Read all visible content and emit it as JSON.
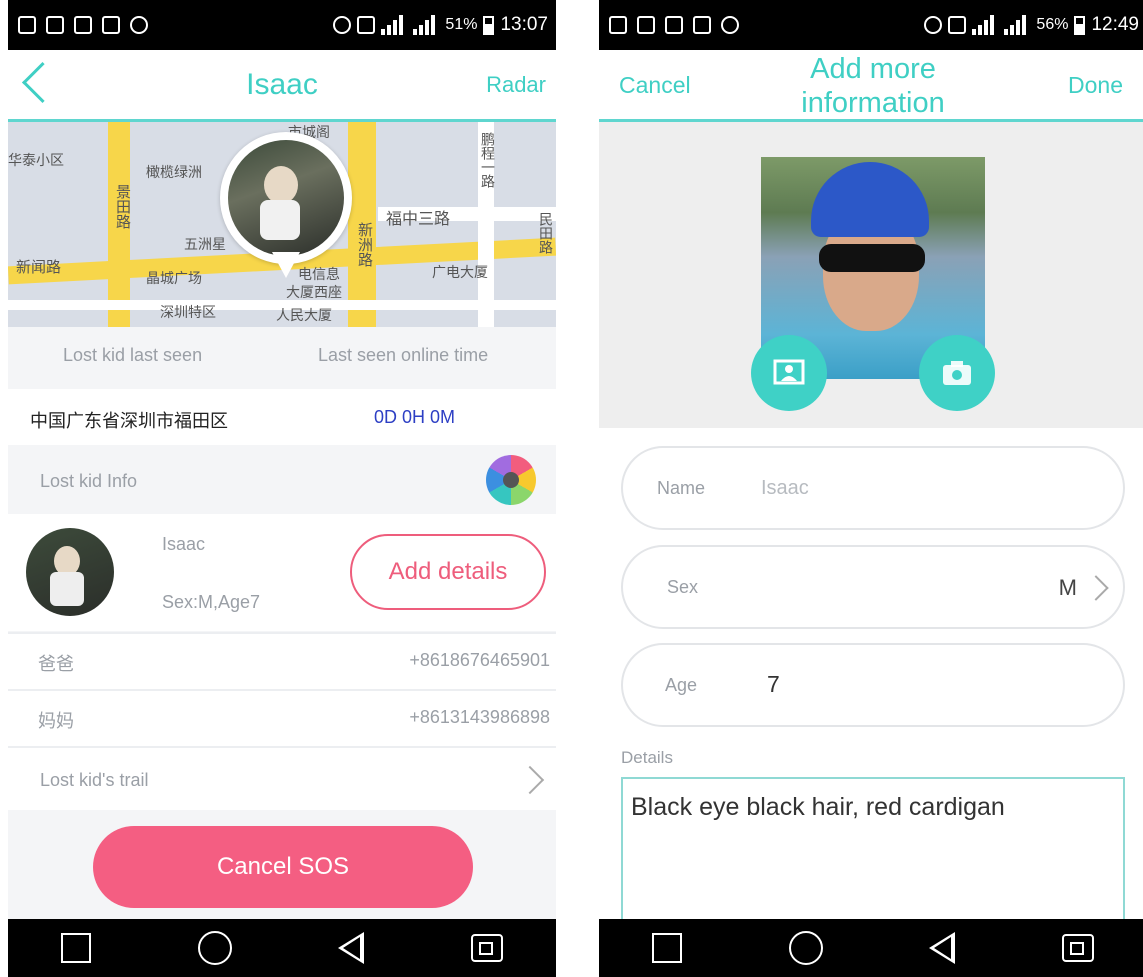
{
  "left": {
    "status": {
      "battery": "51%",
      "time": "13:07"
    },
    "header": {
      "title": "Isaac",
      "action": "Radar"
    },
    "map": {
      "labels": [
        "华泰小区",
        "橄榄绿洲",
        "景田路",
        "五洲星",
        "晶城广场",
        "电信息",
        "大厦西座",
        "深圳特区",
        "人民大厦",
        "福中三路",
        "新洲路",
        "广电大厦",
        "鹏程一路",
        "民田路",
        "新闻路",
        "市城阁"
      ]
    },
    "last_seen": {
      "label": "Lost kid last seen",
      "online_label": "Last seen online time"
    },
    "location": {
      "address": "中国广东省深圳市福田区",
      "elapsed": "0D 0H 0M"
    },
    "info_section": {
      "label": "Lost kid Info"
    },
    "profile": {
      "name": "Isaac",
      "details": "Sex:M,Age7",
      "add_details": "Add details"
    },
    "contacts": [
      {
        "relation": "爸爸",
        "phone": "+8618676465901"
      },
      {
        "relation": "妈妈",
        "phone": "+8613143986898"
      }
    ],
    "trail": {
      "label": "Lost kid's trail"
    },
    "sos": {
      "label": "Cancel SOS"
    },
    "colors": {
      "accent": "#3fcfc4",
      "danger": "#f45e82"
    }
  },
  "right": {
    "status": {
      "battery": "56%",
      "time": "12:49"
    },
    "header": {
      "cancel": "Cancel",
      "title_line1": "Add more",
      "title_line2": "information",
      "done": "Done"
    },
    "form": {
      "name": {
        "label": "Name",
        "placeholder": "Isaac"
      },
      "sex": {
        "label": "Sex",
        "value": "M"
      },
      "age": {
        "label": "Age",
        "value": "7"
      },
      "details": {
        "label": "Details",
        "value": "Black eye black hair, red cardigan"
      }
    }
  }
}
